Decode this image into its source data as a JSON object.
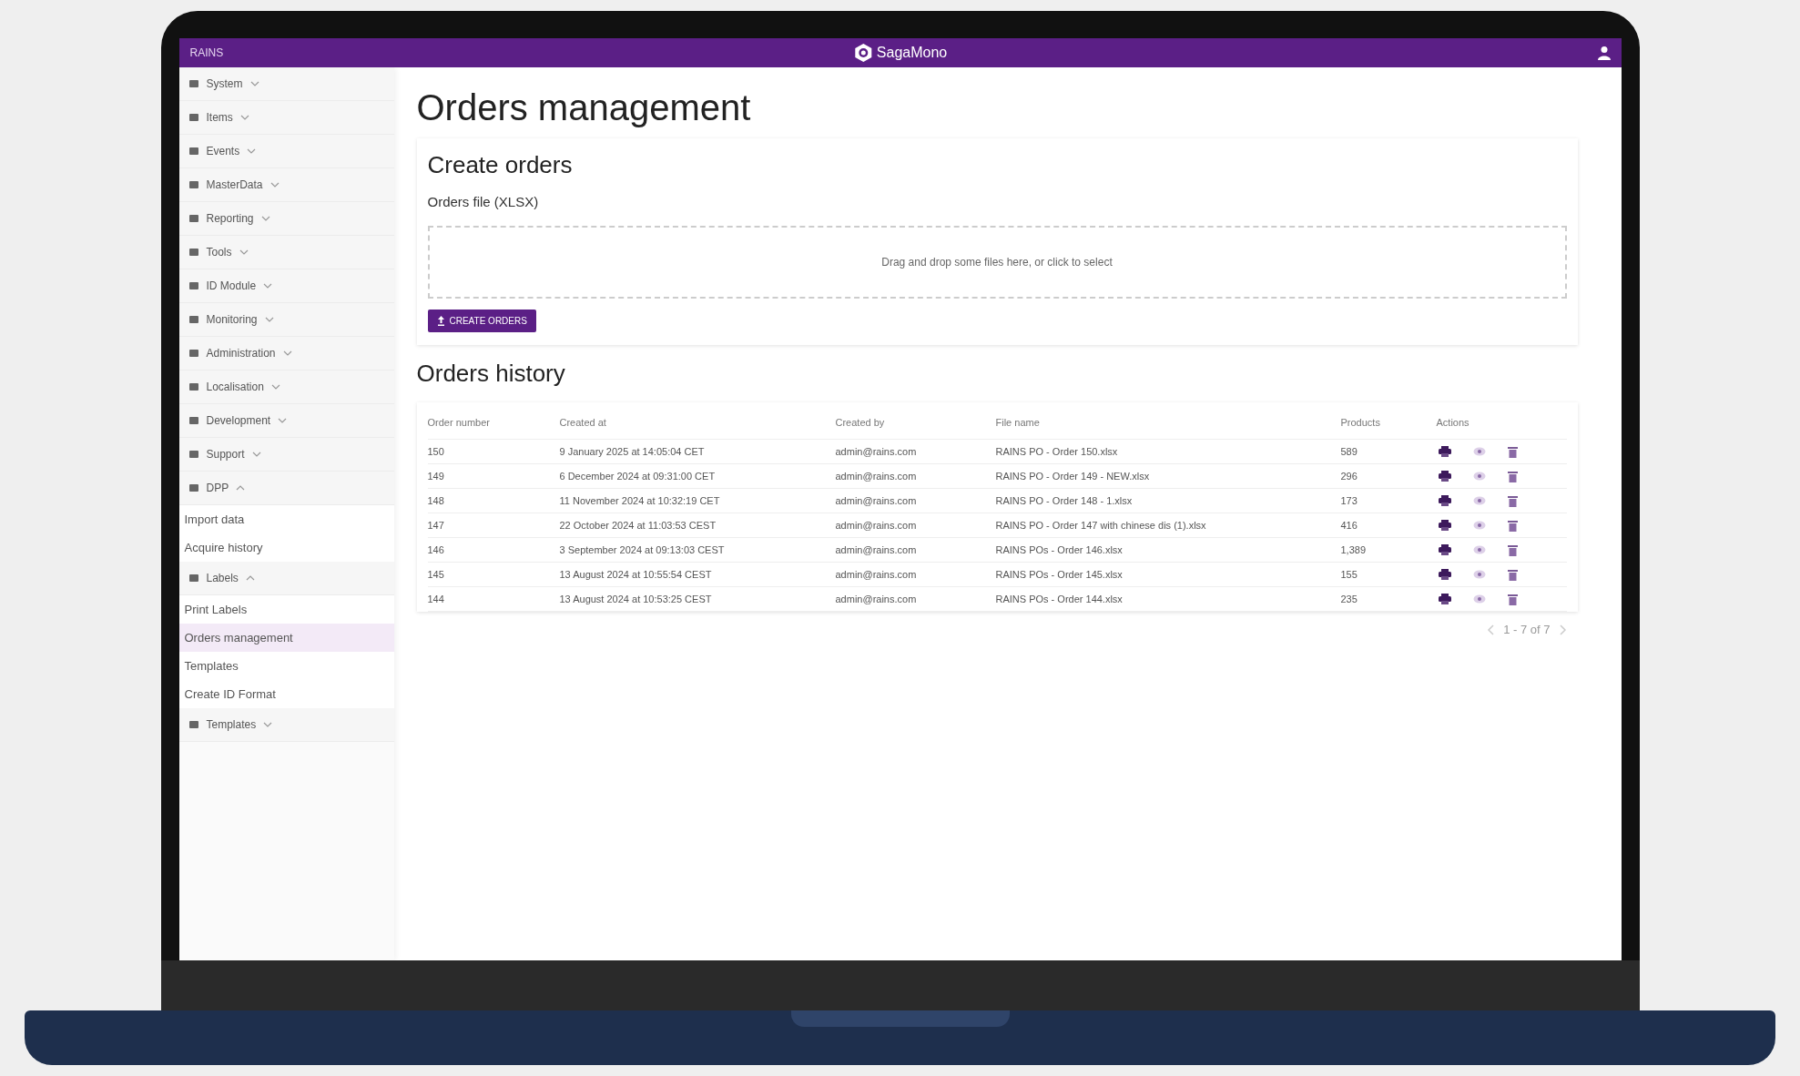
{
  "top_bar": {
    "tenant": "RAINS",
    "brand": "SagaMono"
  },
  "sidebar": {
    "items": [
      {
        "kind": "group",
        "label": "System",
        "expanded": false
      },
      {
        "kind": "group",
        "label": "Items",
        "expanded": false
      },
      {
        "kind": "group",
        "label": "Events",
        "expanded": false
      },
      {
        "kind": "group",
        "label": "MasterData",
        "expanded": false
      },
      {
        "kind": "group",
        "label": "Reporting",
        "expanded": false
      },
      {
        "kind": "group",
        "label": "Tools",
        "expanded": false
      },
      {
        "kind": "group",
        "label": "ID Module",
        "expanded": false
      },
      {
        "kind": "group",
        "label": "Monitoring",
        "expanded": false
      },
      {
        "kind": "group",
        "label": "Administration",
        "expanded": false
      },
      {
        "kind": "group",
        "label": "Localisation",
        "expanded": false
      },
      {
        "kind": "group",
        "label": "Development",
        "expanded": false
      },
      {
        "kind": "group",
        "label": "Support",
        "expanded": false
      },
      {
        "kind": "group",
        "label": "DPP",
        "expanded": true,
        "children": [
          {
            "kind": "link",
            "label": "Import data",
            "selected": false
          },
          {
            "kind": "link",
            "label": "Acquire history",
            "selected": false
          }
        ]
      },
      {
        "kind": "group",
        "label": "Labels",
        "expanded": true,
        "children": [
          {
            "kind": "link",
            "label": "Print Labels",
            "selected": false
          },
          {
            "kind": "link",
            "label": "Orders management",
            "selected": true
          },
          {
            "kind": "link",
            "label": "Templates",
            "selected": false
          },
          {
            "kind": "link",
            "label": "Create ID Format",
            "selected": false
          }
        ]
      },
      {
        "kind": "group",
        "label": "Templates",
        "expanded": false
      }
    ]
  },
  "page_title": "Orders management",
  "create_orders": {
    "title": "Create orders",
    "file_label": "Orders file (XLSX)",
    "dropzone": "Drag and drop some files here, or click to select",
    "button": "CREATE ORDERS"
  },
  "orders_history": {
    "title": "Orders history",
    "columns": [
      "Order number",
      "Created at",
      "Created by",
      "File name",
      "Products",
      "Actions"
    ],
    "rows": [
      [
        "150",
        "9 January 2025 at 14:05:04 CET",
        "admin@rains.com",
        "RAINS PO - Order 150.xlsx",
        "589"
      ],
      [
        "149",
        "6 December 2024 at 09:31:00 CET",
        "admin@rains.com",
        "RAINS PO - Order 149 - NEW.xlsx",
        "296"
      ],
      [
        "148",
        "11 November 2024 at 10:32:19 CET",
        "admin@rains.com",
        "RAINS PO - Order 148 - 1.xlsx",
        "173"
      ],
      [
        "147",
        "22 October 2024 at 11:03:53 CEST",
        "admin@rains.com",
        "RAINS PO - Order 147 with chinese dis (1).xlsx",
        "416"
      ],
      [
        "146",
        "3 September 2024 at 09:13:03 CEST",
        "admin@rains.com",
        "RAINS POs - Order 146.xlsx",
        "1,389"
      ],
      [
        "145",
        "13 August 2024 at 10:55:54 CEST",
        "admin@rains.com",
        "RAINS POs - Order 145.xlsx",
        "155"
      ],
      [
        "144",
        "13 August 2024 at 10:53:25 CEST",
        "admin@rains.com",
        "RAINS POs - Order 144.xlsx",
        "235"
      ]
    ],
    "pagination": "1 - 7 of 7"
  }
}
